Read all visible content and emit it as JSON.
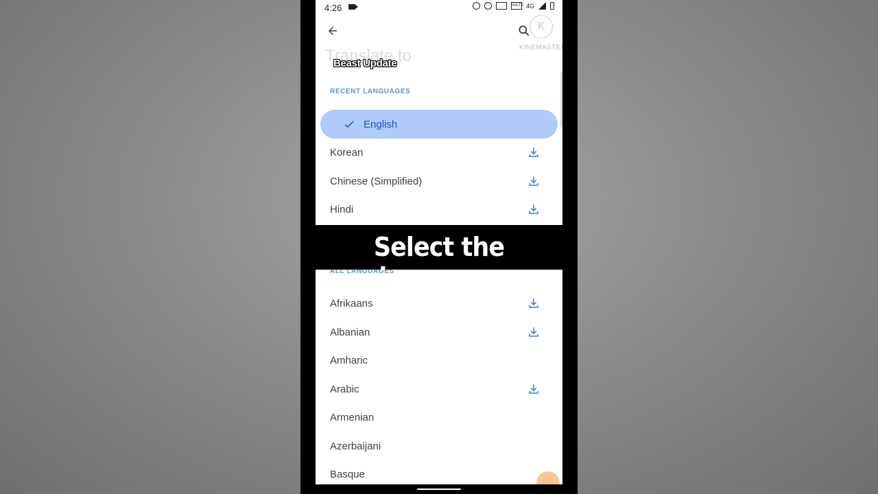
{
  "status_bar": {
    "time": "4:26",
    "badge_vo": "VoLTE",
    "badge_4g": "4G"
  },
  "header": {
    "title": "Translate to",
    "overlay_label": "Beast Update",
    "watermark_logo": "K",
    "watermark_text": "KINEMASTER"
  },
  "recent": {
    "header": "RECENT LANGUAGES",
    "selected": "English",
    "items": [
      {
        "label": "Korean",
        "downloadable": true
      },
      {
        "label": "Chinese (Simplified)",
        "downloadable": true
      },
      {
        "label": "Hindi",
        "downloadable": true
      }
    ]
  },
  "caption": "Select the language",
  "all": {
    "header": "ALL LANGUAGES",
    "items": [
      {
        "label": "Afrikaans",
        "downloadable": true
      },
      {
        "label": "Albanian",
        "downloadable": true
      },
      {
        "label": "Amharic",
        "downloadable": false
      },
      {
        "label": "Arabic",
        "downloadable": true
      },
      {
        "label": "Armenian",
        "downloadable": false
      },
      {
        "label": "Azerbaijani",
        "downloadable": false
      },
      {
        "label": "Basque",
        "downloadable": false
      }
    ]
  },
  "colors": {
    "accent": "#1a73e8",
    "selected_bg": "#aecbfa",
    "section_header": "#5f93c6"
  },
  "icons": [
    "back-arrow-icon",
    "search-icon",
    "check-icon",
    "download-icon"
  ]
}
